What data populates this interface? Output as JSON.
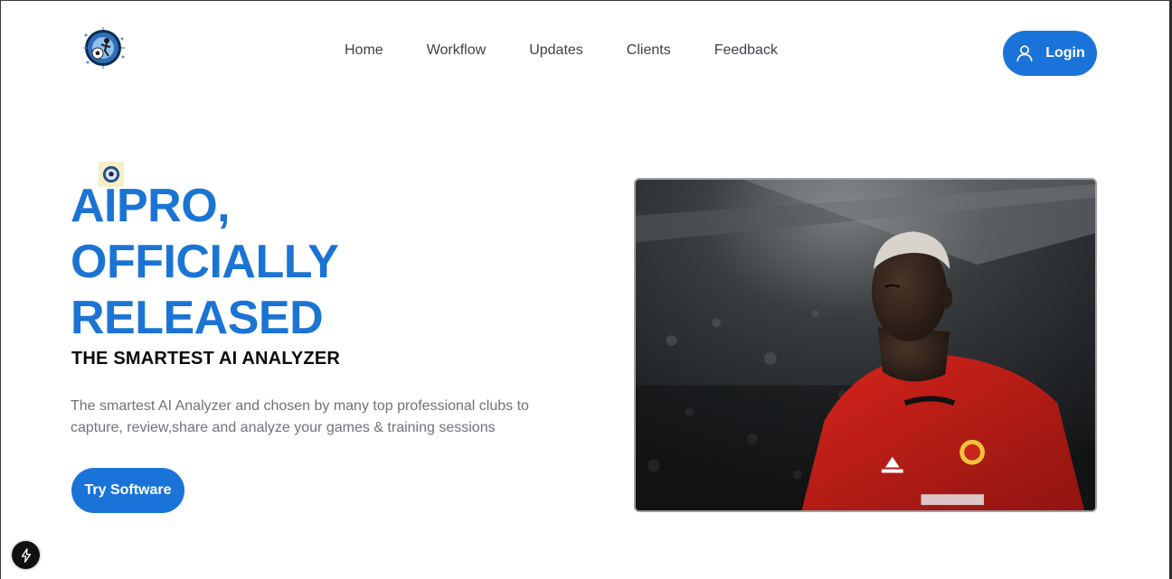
{
  "header": {
    "logo_icon": "soccer-analytics-logo",
    "nav": [
      {
        "label": "Home"
      },
      {
        "label": "Workflow"
      },
      {
        "label": "Updates"
      },
      {
        "label": "Clients"
      },
      {
        "label": "Feedback"
      }
    ],
    "login_label": "Login",
    "login_icon": "user-icon"
  },
  "hero": {
    "badge_icon": "soccer-ball-icon",
    "title_lines": [
      "AIPRO,",
      "OFFICIALLY",
      "RELEASED"
    ],
    "subtitle": "THE SMARTEST AI ANALYZER",
    "description": "The smartest AI Analyzer and chosen by many top professional clubs to capture, review,share and analyze your games & training sessions",
    "cta_label": "Try Software",
    "image_icon": "football-player-photo"
  },
  "dev_badge_icon": "lightning-icon",
  "colors": {
    "accent": "#1a73d9",
    "title": "#1b74d3",
    "body_text": "#71717a",
    "nav_text": "#3f3f46"
  }
}
